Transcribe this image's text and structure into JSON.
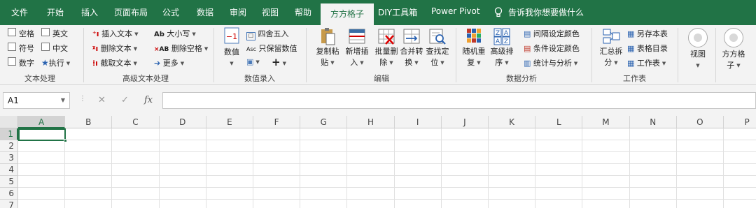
{
  "tabs": [
    "文件",
    "开始",
    "插入",
    "页面布局",
    "公式",
    "数据",
    "审阅",
    "视图",
    "帮助",
    "方方格子",
    "DIY工具箱",
    "Power Pivot"
  ],
  "tell_me": "告诉我你想要做什么",
  "text_group": {
    "checkboxes": [
      "空格",
      "英文",
      "符号",
      "中文",
      "数字"
    ],
    "execute": "执行",
    "label": "文本处理"
  },
  "adv_text_group": {
    "items": [
      "插入文本",
      "删除文本",
      "截取文本",
      "大小写",
      "删除空格",
      "更多"
    ],
    "label": "高级文本处理"
  },
  "number_group": {
    "value_btn": "数值",
    "round": "四舍五入",
    "keep_value": "只保留数值",
    "label": "数值录入"
  },
  "edit_group": {
    "buttons": [
      {
        "line1": "复制粘",
        "line2": "贴"
      },
      {
        "line1": "新增插",
        "line2": "入"
      },
      {
        "line1": "批量删",
        "line2": "除"
      },
      {
        "line1": "合并转",
        "line2": "换"
      },
      {
        "line1": "查找定",
        "line2": "位"
      }
    ],
    "label": "编辑"
  },
  "analysis_group": {
    "buttons": [
      {
        "line1": "随机重",
        "line2": "复"
      },
      {
        "line1": "高级排",
        "line2": "序"
      }
    ],
    "small": [
      "间隔设定颜色",
      "条件设定颜色",
      "统计与分析"
    ],
    "label": "数据分析"
  },
  "sheet_group": {
    "summary": {
      "line1": "汇总拆",
      "line2": "分"
    },
    "small": [
      "另存本表",
      "表格目录",
      "工作表"
    ],
    "label": "工作表"
  },
  "view_btn": "视图",
  "ffgz_btn": {
    "line1": "方方格",
    "line2": "子"
  },
  "formula_bar": {
    "name_box": "A1",
    "fx": "fx",
    "cancel": "✕",
    "enter": "✓",
    "value": ""
  },
  "columns": [
    "A",
    "B",
    "C",
    "D",
    "E",
    "F",
    "G",
    "H",
    "I",
    "J",
    "K",
    "L",
    "M",
    "N",
    "O",
    "P"
  ],
  "rows": [
    "1",
    "2",
    "3",
    "4",
    "5",
    "6",
    "7"
  ],
  "selected_cell": "A1",
  "colors": {
    "accent": "#217346"
  }
}
